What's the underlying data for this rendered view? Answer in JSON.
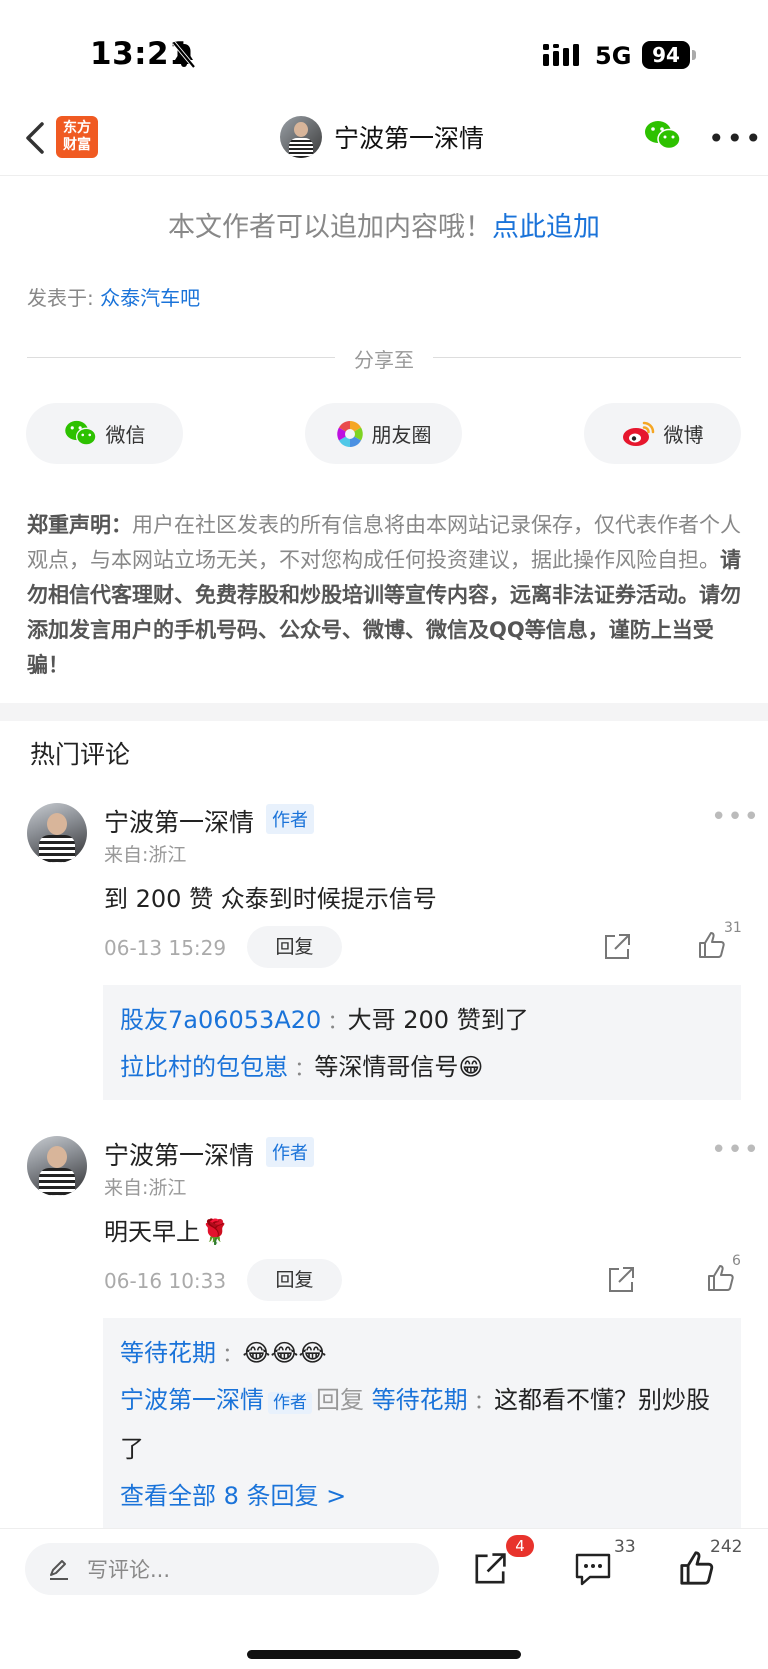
{
  "status_bar": {
    "time": "13:21",
    "network": "5G",
    "battery": "94"
  },
  "nav": {
    "logo_line1": "东方",
    "logo_line2": "财富",
    "title": "宁波第一深情"
  },
  "append": {
    "text": "本文作者可以追加内容哦！",
    "link": "点此追加"
  },
  "posted": {
    "label": "发表于:",
    "forum": "众泰汽车吧"
  },
  "share": {
    "label": "分享至",
    "wechat": "微信",
    "moments": "朋友圈",
    "weibo": "微博"
  },
  "disclaimer": {
    "title": "郑重声明：",
    "body": "用户在社区发表的所有信息将由本网站记录保存，仅代表作者个人观点，与本网站立场无关，不对您构成任何投资建议，据此操作风险自担。",
    "bold": "请勿相信代客理财、免费荐股和炒股培训等宣传内容，远离非法证券活动。请勿添加发言用户的手机号码、公众号、微博、微信及QQ等信息，谨防上当受骗！"
  },
  "hot_comments": {
    "title": "热门评论",
    "author_tag": "作者",
    "reply_label": "回复",
    "items": [
      {
        "user": "宁波第一深情",
        "location": "来自:浙江",
        "text": "到 200 赞 众泰到时候提示信号",
        "time": "06-13 15:29",
        "likes": "31",
        "replies": [
          {
            "user": "股友7a06053A20",
            "text": "大哥 200 赞到了"
          },
          {
            "user": "拉比村的包包崽",
            "text": "等深情哥信号😁"
          }
        ]
      },
      {
        "user": "宁波第一深情",
        "location": "来自:浙江",
        "text": "明天早上🌹",
        "time": "06-16 10:33",
        "likes": "6",
        "replies": [
          {
            "user": "等待花期",
            "text": "😂😂😂"
          },
          {
            "user": "宁波第一深情",
            "reply_word": "回复",
            "target": "等待花期",
            "text": "这都看不懂？别炒股了"
          }
        ],
        "view_all": "查看全部 8 条回复 >"
      }
    ]
  },
  "bottom_bar": {
    "placeholder": "写评论...",
    "share_badge": "4",
    "comments": "33",
    "likes": "242"
  }
}
